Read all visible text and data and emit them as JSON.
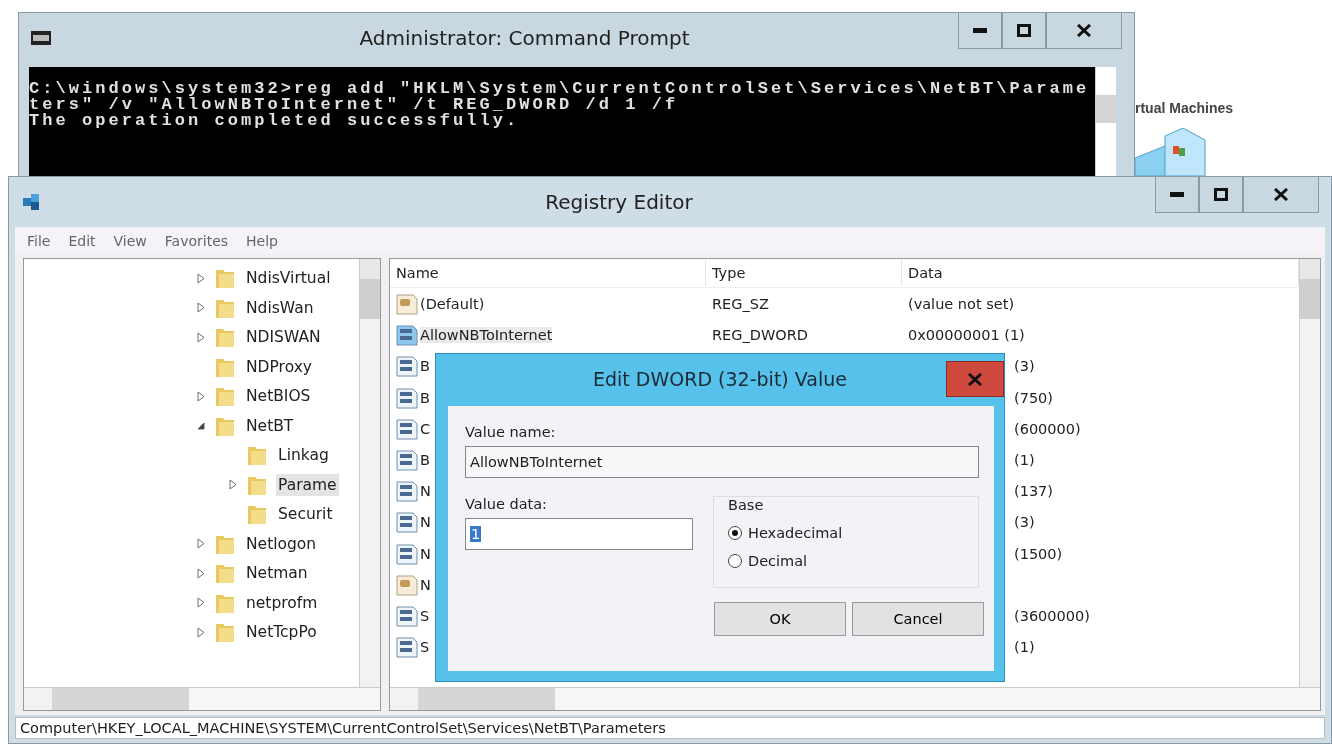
{
  "command_prompt": {
    "title": "Administrator: Command Prompt",
    "lines": [
      "C:\\windows\\system32>reg add \"HKLM\\System\\CurrentControlSet\\Services\\NetBT\\Parame",
      "ters\" /v \"AllowNBToInternet\" /t REG_DWORD /d 1 /f",
      "The operation completed successfully."
    ]
  },
  "desktop_icon": {
    "label": "rtual Machines"
  },
  "registry_editor": {
    "title": "Registry Editor",
    "menu": [
      "File",
      "Edit",
      "View",
      "Favorites",
      "Help"
    ],
    "tree": [
      {
        "label": "NdisVirtual",
        "expandable": true,
        "expanded": false,
        "selected": false
      },
      {
        "label": "NdisWan",
        "expandable": true,
        "expanded": false,
        "selected": false
      },
      {
        "label": "NDISWAN",
        "expandable": true,
        "expanded": false,
        "selected": false
      },
      {
        "label": "NDProxy",
        "expandable": false,
        "selected": false
      },
      {
        "label": "NetBIOS",
        "expandable": true,
        "expanded": false,
        "selected": false
      },
      {
        "label": "NetBT",
        "expandable": true,
        "expanded": true,
        "selected": false,
        "children": [
          {
            "label": "Linkag",
            "expandable": false,
            "selected": false
          },
          {
            "label": "Parame",
            "expandable": true,
            "expanded": false,
            "selected": true
          },
          {
            "label": "Securit",
            "expandable": false,
            "selected": false
          }
        ]
      },
      {
        "label": "Netlogon",
        "expandable": true,
        "expanded": false,
        "selected": false
      },
      {
        "label": "Netman",
        "expandable": true,
        "expanded": false,
        "selected": false
      },
      {
        "label": "netprofm",
        "expandable": true,
        "expanded": false,
        "selected": false
      },
      {
        "label": "NetTcpPo",
        "expandable": true,
        "expanded": false,
        "selected": false
      }
    ],
    "columns": [
      "Name",
      "Type",
      "Data"
    ],
    "rows": [
      {
        "kind": "string",
        "name": "(Default)",
        "type": "REG_SZ",
        "data": "(value not set)"
      },
      {
        "kind": "dword",
        "name": "AllowNBToInternet",
        "type": "REG_DWORD",
        "data": "0x00000001 (1)"
      },
      {
        "kind": "dword",
        "name": "B",
        "data": "(3)"
      },
      {
        "kind": "dword",
        "name": "B",
        "data": "(750)"
      },
      {
        "kind": "dword",
        "name": "C",
        "data": "(600000)"
      },
      {
        "kind": "dword",
        "name": "B",
        "data": "(1)"
      },
      {
        "kind": "dword",
        "name": "N",
        "data": "(137)"
      },
      {
        "kind": "dword",
        "name": "N",
        "data": "(3)"
      },
      {
        "kind": "dword",
        "name": "N",
        "data": "(1500)"
      },
      {
        "kind": "string",
        "name": "N"
      },
      {
        "kind": "dword",
        "name": "S",
        "data": "(3600000)"
      },
      {
        "kind": "dword",
        "name": "S",
        "data": "(1)"
      }
    ],
    "status_bar": "Computer\\HKEY_LOCAL_MACHINE\\SYSTEM\\CurrentControlSet\\Services\\NetBT\\Parameters"
  },
  "dialog": {
    "title": "Edit DWORD (32-bit) Value",
    "value_name_label": "Value name:",
    "value_name": "AllowNBToInternet",
    "value_data_label": "Value data:",
    "value_data": "1",
    "base_label": "Base",
    "bases": [
      {
        "label": "Hexadecimal",
        "selected": true
      },
      {
        "label": "Decimal",
        "selected": false
      }
    ],
    "buttons": [
      "OK",
      "Cancel"
    ]
  }
}
